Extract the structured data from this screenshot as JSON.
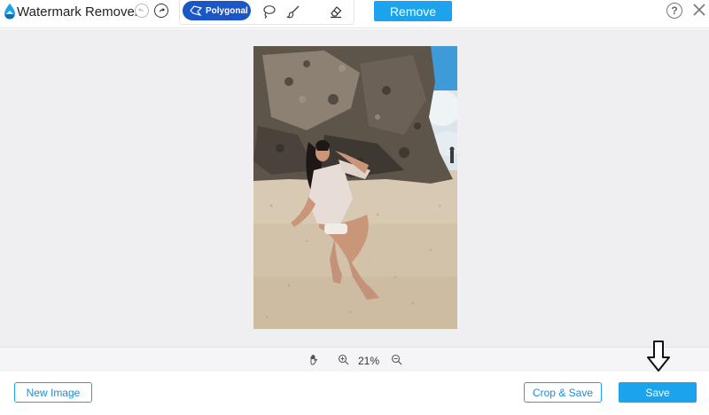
{
  "app": {
    "title": "Watermark Remover",
    "brand_color": "#1ba3ee",
    "accent_color": "#1a56c8"
  },
  "toolbar": {
    "undo_icon": "undo-icon",
    "redo_icon": "redo-icon",
    "polygonal_label": "Polygonal",
    "lasso_icon": "lasso-icon",
    "brush_icon": "brush-icon",
    "eraser_icon": "eraser-icon",
    "remove_label": "Remove",
    "help_label": "?",
    "close_icon": "close-icon"
  },
  "zoom": {
    "value": "21%",
    "pan_icon": "hand-icon",
    "zoom_in_icon": "zoom-in-icon",
    "zoom_out_icon": "zoom-out-icon"
  },
  "footer": {
    "new_image_label": "New Image",
    "crop_save_label": "Crop & Save",
    "save_label": "Save",
    "pointer_icon": "down-arrow-icon"
  }
}
